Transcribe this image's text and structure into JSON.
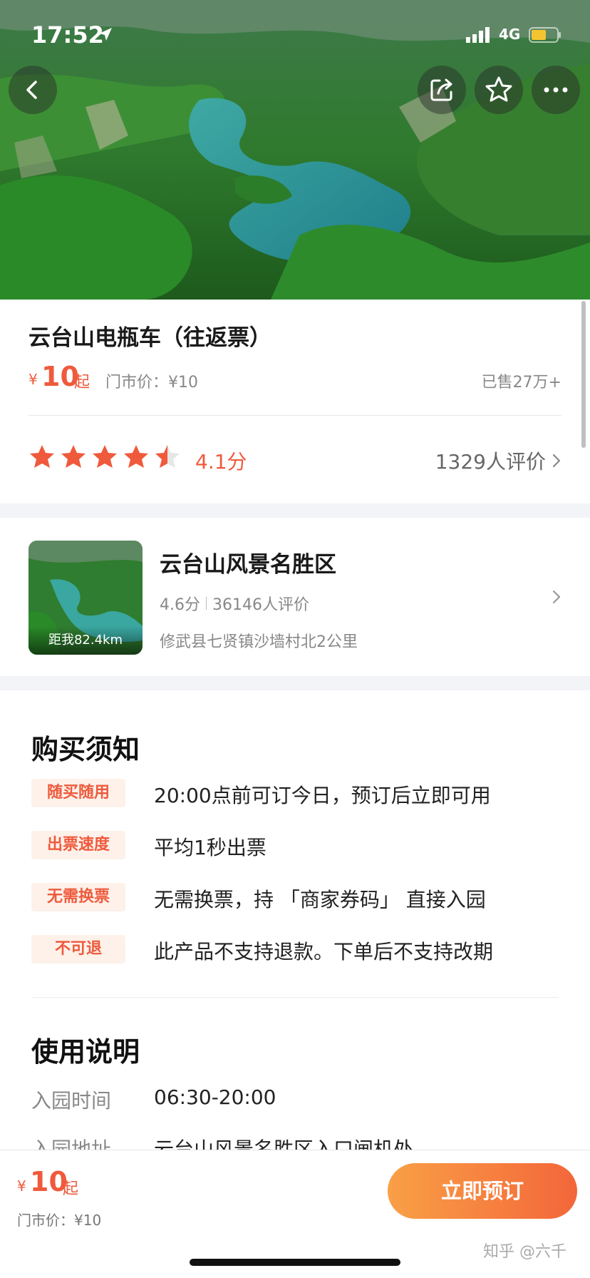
{
  "status_bar": {
    "time": "17:52",
    "network": "4G"
  },
  "header_icons": {
    "back": "back-arrow-icon",
    "share": "share-icon",
    "favorite": "star-outline-icon",
    "more": "more-dots-icon"
  },
  "product": {
    "title": "云台山电瓶车（往返票）",
    "price_symbol": "¥",
    "price": "10",
    "price_suffix": "起",
    "market_price": "门市价：¥10",
    "sold": "已售27万+",
    "rating_stars": 4.1,
    "rating_text": "4.1分",
    "reviews": "1329人评价"
  },
  "scenic": {
    "name": "云台山风景名胜区",
    "score": "4.6分",
    "reviews": "36146人评价",
    "address": "修武县七贤镇沙墙村北2公里",
    "distance": "距我82.4km"
  },
  "notice": {
    "title": "购买须知",
    "items": [
      {
        "tag": "随买随用",
        "text": "20:00点前可订今日，预订后立即可用"
      },
      {
        "tag": "出票速度",
        "text": "平均1秒出票"
      },
      {
        "tag": "无需换票",
        "text": "无需换票，持 「商家券码」 直接入园"
      },
      {
        "tag": "不可退",
        "text": "此产品不支持退款。下单后不支持改期"
      }
    ]
  },
  "usage": {
    "title": "使用说明",
    "rows": [
      {
        "label": "入园时间",
        "value": "06:30-20:00"
      },
      {
        "label": "入园地址",
        "value": "云台山风景名胜区入口闸机处"
      }
    ]
  },
  "bottom_bar": {
    "price_symbol": "¥",
    "price": "10",
    "price_suffix": "起",
    "market_price": "门市价：¥10",
    "book_button": "立即预订",
    "watermark": "知乎 @六千"
  },
  "colors": {
    "accent": "#ef5a3c",
    "button_start": "#f9a046",
    "button_end": "#f3663a",
    "tag_bg": "#fdf1ea"
  }
}
